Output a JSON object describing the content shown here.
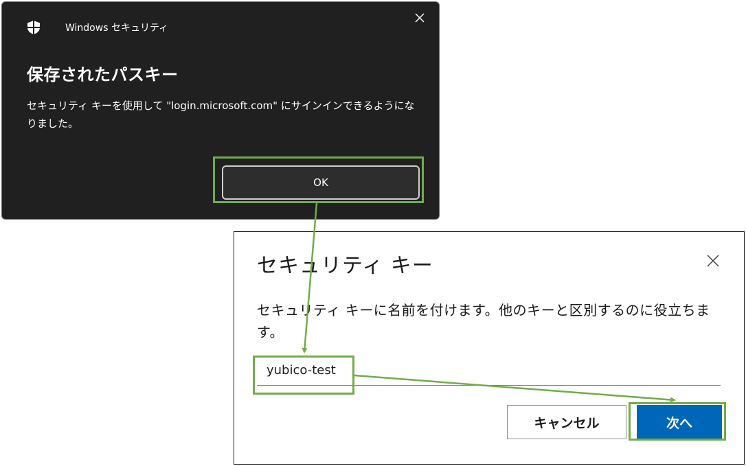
{
  "windows_dialog": {
    "app_title": "Windows セキュリティ",
    "heading": "保存されたパスキー",
    "message": "セキュリティ キーを使用して \"login.microsoft.com\" にサインインできるようになりました。",
    "ok_label": "OK",
    "shield_icon": "shield-icon",
    "close_icon": "close-icon"
  },
  "security_key_dialog": {
    "title": "セキュリティ キー",
    "description": "セキュリティ キーに名前を付けます。他のキーと区別するのに役立ちます。",
    "name_input_value": "yubico-test",
    "cancel_label": "キャンセル",
    "next_label": "次へ",
    "close_icon": "close-icon"
  },
  "colors": {
    "annotation_green": "#70ad47",
    "primary_blue": "#0067b8",
    "dark_dialog_bg": "#202020"
  }
}
